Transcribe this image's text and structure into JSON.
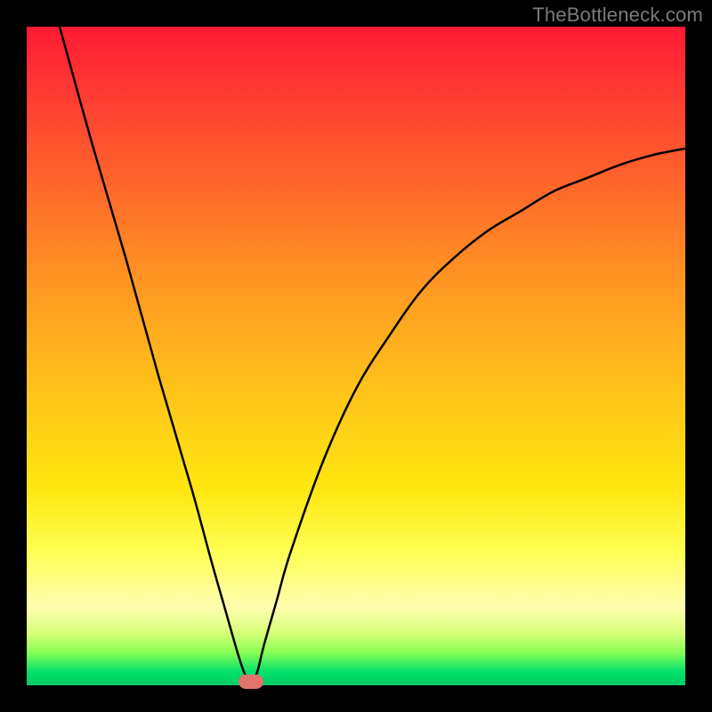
{
  "attribution": "TheBottleneck.com",
  "colors": {
    "background": "#000000",
    "curve": "#000000",
    "gradient_top": "#ff1a33",
    "gradient_mid": "#ffe60f",
    "gradient_bottom": "#00cc66",
    "marker": "#e2736d"
  },
  "chart_data": {
    "type": "line",
    "title": "",
    "xlabel": "",
    "ylabel": "",
    "xlim": [
      0,
      100
    ],
    "ylim": [
      0,
      100
    ],
    "series": [
      {
        "name": "bottleneck-curve",
        "x": [
          5,
          10,
          15,
          20,
          25,
          28,
          30,
          32,
          33,
          34,
          35,
          36,
          38,
          40,
          45,
          50,
          55,
          60,
          65,
          70,
          75,
          80,
          85,
          90,
          95,
          100
        ],
        "y": [
          100,
          82,
          65,
          47,
          30,
          19,
          12,
          5,
          2,
          0,
          2,
          6,
          13,
          20,
          34,
          45,
          53,
          60,
          65,
          69,
          72,
          75,
          77,
          79,
          80.5,
          81.5
        ]
      }
    ],
    "annotations": [
      {
        "name": "minimum-marker",
        "x": 34,
        "y": 0
      }
    ],
    "grid": false,
    "legend": false
  }
}
